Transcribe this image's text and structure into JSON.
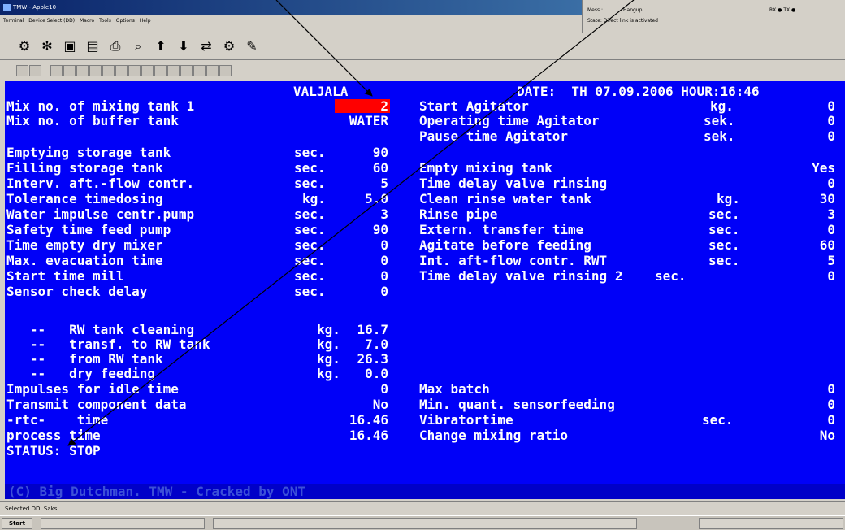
{
  "window": {
    "title": "TMW - Apple10",
    "menu": [
      "Terminal",
      "Device Select (DD)",
      "Macro",
      "Tools",
      "Options",
      "Help"
    ],
    "status_panel": {
      "line1_left": "Mess.:",
      "line1_mid": "Hangup",
      "line1_right": "RX ● TX ●",
      "line2": "State: Direct link is activated"
    }
  },
  "terminal": {
    "header": {
      "location": "VALJALA",
      "date": "DATE:  TH 07.09.2006 HOUR:16:46"
    },
    "left_rows": [
      {
        "label": "Mix no. of mixing tank 1",
        "unit": "",
        "value": "2"
      },
      {
        "label": "Mix no. of buffer tank",
        "unit": "",
        "value": "WATER"
      },
      {
        "label": "Emptying storage tank",
        "unit": "sec.",
        "value": "90"
      },
      {
        "label": "Filling storage tank",
        "unit": "sec.",
        "value": "60"
      },
      {
        "label": "Interv. aft.-flow contr.",
        "unit": "sec.",
        "value": "5"
      },
      {
        "label": "Tolerance timedosing",
        "unit": "kg.",
        "value": "5.0"
      },
      {
        "label": "Water impulse centr.pump",
        "unit": "sec.",
        "value": "3"
      },
      {
        "label": "Safety time feed pump",
        "unit": "sec.",
        "value": "90"
      },
      {
        "label": "Time empty dry mixer",
        "unit": "sec.",
        "value": "0"
      },
      {
        "label": "Max. evacuation time",
        "unit": "sec.",
        "value": "0"
      },
      {
        "label": "Start time mill",
        "unit": "sec.",
        "value": "0"
      },
      {
        "label": "Sensor check delay",
        "unit": "sec.",
        "value": "0"
      },
      {
        "label": "   --   RW tank cleaning",
        "unit": "kg.",
        "value": "16.7"
      },
      {
        "label": "   --   transf. to RW tank",
        "unit": "kg.",
        "value": "7.0"
      },
      {
        "label": "   --   from RW tank",
        "unit": "kg.",
        "value": "26.3"
      },
      {
        "label": "   --   dry feeding",
        "unit": "kg.",
        "value": "0.0"
      },
      {
        "label": "Impulses for idle time",
        "unit": "",
        "value": "0"
      },
      {
        "label": "Transmit component data",
        "unit": "",
        "value": "No"
      },
      {
        "label": "-rtc-    time",
        "unit": "",
        "value": "16.46"
      },
      {
        "label": "process time",
        "unit": "",
        "value": "16.46"
      }
    ],
    "right_rows": [
      {
        "label": "Start Agitator",
        "unit": "kg.",
        "value": "0"
      },
      {
        "label": "Operating time Agitator",
        "unit": "sek.",
        "value": "0"
      },
      {
        "label": "Pause time Agitator",
        "unit": "sek.",
        "value": "0"
      },
      {
        "label": "Empty mixing tank",
        "unit": "",
        "value": "Yes"
      },
      {
        "label": "Time delay valve rinsing",
        "unit": "",
        "value": "0"
      },
      {
        "label": "Clean rinse water tank",
        "unit": "kg.",
        "value": "30"
      },
      {
        "label": "Rinse pipe",
        "unit": "sec.",
        "value": "3"
      },
      {
        "label": "Extern. transfer time",
        "unit": "sec.",
        "value": "0"
      },
      {
        "label": "Agitate before feeding",
        "unit": "sec.",
        "value": "60"
      },
      {
        "label": "Int. aft-flow contr. RWT",
        "unit": "sec.",
        "value": "5"
      },
      {
        "label": "Time delay valve rinsing 2",
        "unit": "sec.",
        "value": "0"
      },
      {
        "label": "Max batch",
        "unit": "",
        "value": "0"
      },
      {
        "label": "Min. quant. sensorfeeding",
        "unit": "",
        "value": "0"
      },
      {
        "label": "Vibratortime",
        "unit": "sec.",
        "value": "0"
      },
      {
        "label": "Change mixing ratio",
        "unit": "",
        "value": "No"
      }
    ],
    "status": "STATUS: STOP",
    "footer": "(C) Big Dutchman. TMW - Cracked by ONT"
  },
  "status_bar": "Selected DD: Saks",
  "taskbar": {
    "start_label": "Start"
  },
  "colors": {
    "terminal_bg": "#0000f8",
    "terminal_text": "#fefefe",
    "highlight": "#ff0000",
    "chrome": "#d4d0c8"
  }
}
